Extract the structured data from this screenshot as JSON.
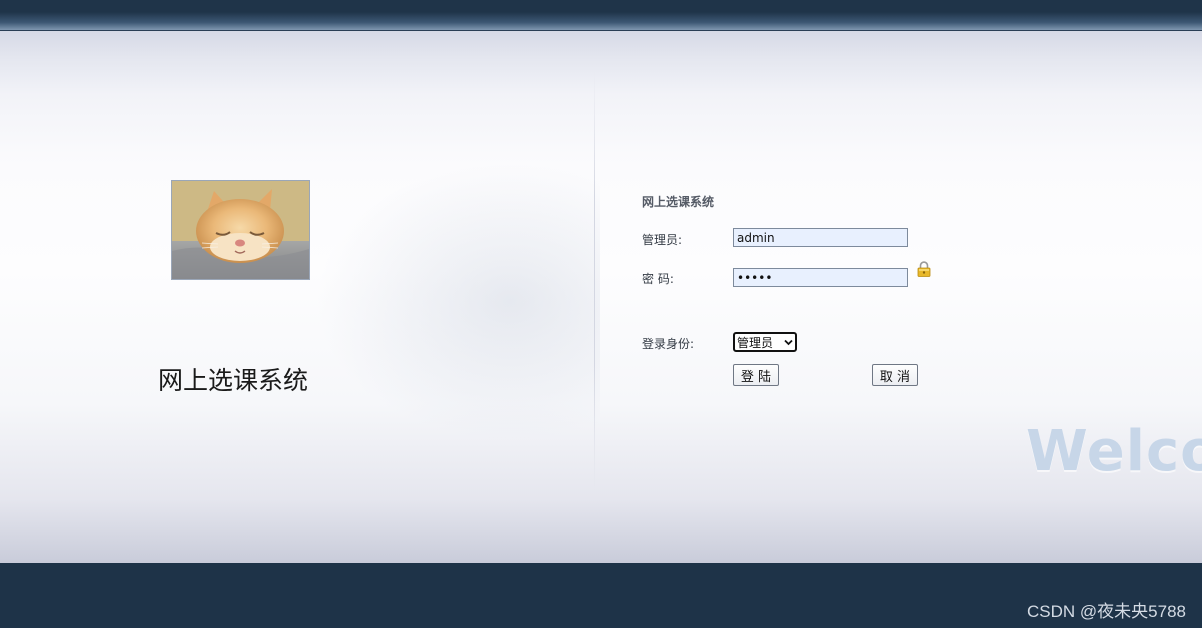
{
  "left_panel": {
    "system_title": "网上选课系统"
  },
  "login": {
    "title": "网上选课系统",
    "username_label": "管理员:",
    "username_value": "admin",
    "password_label": "密  码:",
    "password_value": "admin",
    "role_label": "登录身份:",
    "role_selected": "管理员",
    "login_button": "登 陆",
    "cancel_button": "取 消"
  },
  "background": {
    "welcome_text": "Welcome"
  },
  "footer": {
    "watermark": "CSDN @夜未央5788"
  },
  "colors": {
    "header_dark": "#1e3348",
    "input_fill": "#e8f0fe",
    "welcome_text": "#c7d6e8"
  },
  "icons": {
    "lock": "lock-icon",
    "dropdown": "chevron-down-icon"
  }
}
